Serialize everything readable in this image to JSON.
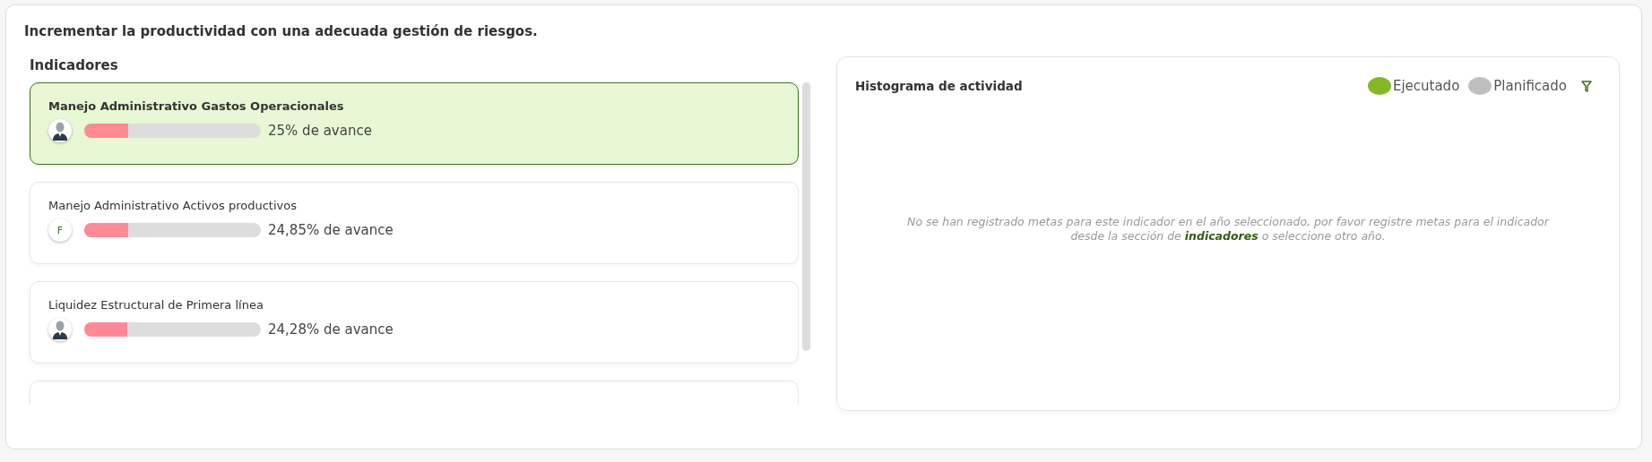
{
  "title": "Incrementar la productividad con una adecuada gestión de riesgos.",
  "indicators_heading": "Indicadores",
  "indicators": [
    {
      "name": "Manejo Administrativo Gastos Operacionales",
      "avatar": {
        "kind": "person"
      },
      "level": 0.25,
      "reading": "25% de avance",
      "selected": true
    },
    {
      "name": "Manejo Administrativo Activos productivos",
      "avatar": {
        "kind": "initial",
        "text": "F"
      },
      "level": 0.2485,
      "reading": "24,85% de avance",
      "selected": false
    },
    {
      "name": "Liquidez Estructural de Primera línea",
      "avatar": {
        "kind": "person"
      },
      "level": 0.2428,
      "reading": "24,28% de avance",
      "selected": false
    },
    {
      "selected": false
    }
  ],
  "histogram": {
    "title": "Histograma de actividad",
    "legend": [
      {
        "label": "Ejecutado",
        "color": "#84b923"
      },
      {
        "label": "Planificado",
        "color": "#bfbfbf"
      }
    ],
    "message": {
      "before": "No se han registrado metas para este indicador en el año seleccionado, por favor registre metas para el indicador desde la sección de",
      "link": "indicadores",
      "after": "o seleccione otro año."
    }
  }
}
